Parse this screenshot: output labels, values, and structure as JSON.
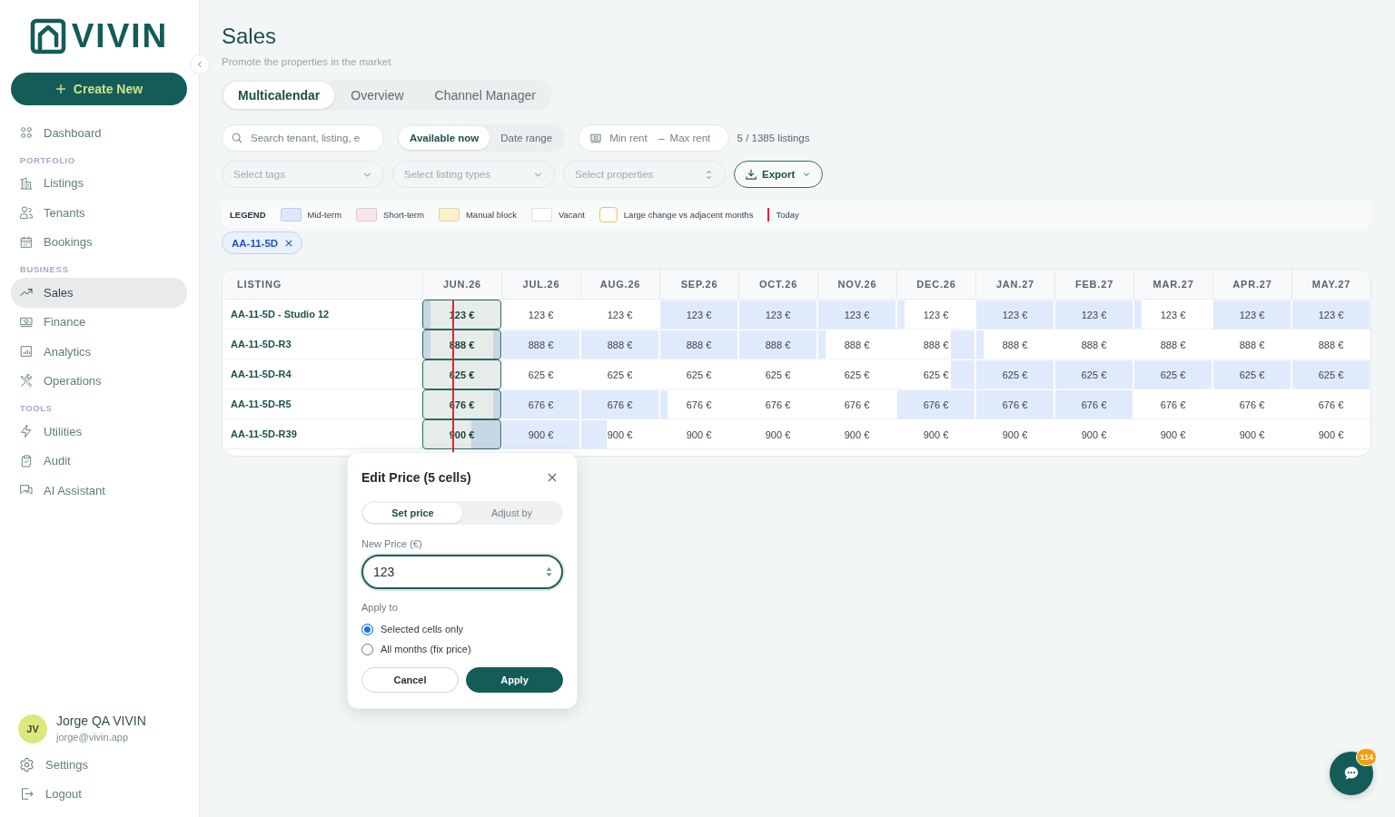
{
  "sidebar": {
    "logo_text": "VIVIN",
    "create_button": "Create New",
    "nav_groups": [
      {
        "items": [
          {
            "label": "Dashboard",
            "selected": false
          }
        ]
      },
      {
        "heading": "PORTFOLIO",
        "items": [
          {
            "label": "Listings",
            "selected": false
          },
          {
            "label": "Tenants",
            "selected": false
          },
          {
            "label": "Bookings",
            "selected": false
          }
        ]
      },
      {
        "heading": "BUSINESS",
        "items": [
          {
            "label": "Sales",
            "selected": true
          },
          {
            "label": "Finance",
            "selected": false
          },
          {
            "label": "Analytics",
            "selected": false
          },
          {
            "label": "Operations",
            "selected": false
          }
        ]
      },
      {
        "heading": "TOOLS",
        "items": [
          {
            "label": "Utilities",
            "selected": false
          },
          {
            "label": "Audit",
            "selected": false
          },
          {
            "label": "AI Assistant",
            "selected": false
          }
        ]
      }
    ],
    "user": {
      "initials": "JV",
      "name": "Jorge QA VIVIN",
      "email": "jorge@vivin.app"
    },
    "account_links": [
      {
        "label": "Settings"
      },
      {
        "label": "Logout"
      }
    ]
  },
  "header": {
    "title": "Sales",
    "subtitle": "Promote the properties in the market"
  },
  "tabs": [
    {
      "label": "Multicalendar",
      "selected": true
    },
    {
      "label": "Overview",
      "selected": false
    },
    {
      "label": "Channel Manager",
      "selected": false
    }
  ],
  "filters": {
    "search": {
      "placeholder": "Search tenant, listing, e"
    },
    "availability": [
      {
        "label": "Available now",
        "selected": true
      },
      {
        "label": "Date range",
        "selected": false
      }
    ],
    "rent": {
      "min": {
        "placeholder": "Min rent"
      },
      "separator": "–",
      "max": {
        "placeholder": "Max rent"
      }
    },
    "result_count": "5 / 1385 listings",
    "selects": [
      {
        "kind": "dropdown",
        "placeholder": "Select tags"
      },
      {
        "kind": "dropdown",
        "placeholder": "Select listing types"
      },
      {
        "kind": "sort",
        "placeholder": "Select properties"
      }
    ],
    "export_button": "Export"
  },
  "legend": {
    "title": "LEGEND",
    "items": [
      {
        "kind": "fill",
        "label": "Mid-term",
        "color": "#dce8fb"
      },
      {
        "kind": "fill",
        "label": "Short-term",
        "color": "#fce4ee"
      },
      {
        "kind": "fill",
        "label": "Manual block",
        "color": "#fdf0c6"
      },
      {
        "kind": "fill",
        "label": "Vacant",
        "color": "#ffffff"
      },
      {
        "kind": "outline",
        "label": "Large change vs adjacent months",
        "color": "#f5c23c"
      },
      {
        "kind": "line",
        "label": "Today",
        "color": "#e0262f"
      }
    ]
  },
  "active_filters": [
    {
      "label": "AA-11-5D"
    }
  ],
  "table": {
    "listing_header": "LISTING",
    "columns": [
      {
        "label": "JUN.26",
        "today": true
      },
      {
        "label": "JUL.26",
        "today": false
      },
      {
        "label": "AUG.26",
        "today": false
      },
      {
        "label": "SEP.26",
        "today": false
      },
      {
        "label": "OCT.26",
        "today": false
      },
      {
        "label": "NOV.26",
        "today": false
      },
      {
        "label": "DEC.26",
        "today": false
      },
      {
        "label": "JAN.27",
        "today": false
      },
      {
        "label": "FEB.27",
        "today": false
      },
      {
        "label": "MAR.27",
        "today": false
      },
      {
        "label": "APR.27",
        "today": false
      },
      {
        "label": "MAY.27",
        "today": false
      }
    ],
    "rows": [
      {
        "listing": "AA-11-5D - Studio 12",
        "cells": [
          {
            "price": "123 €",
            "selected": true,
            "kind": "end"
          },
          {
            "price": "123 €",
            "selected": false,
            "kind": "none"
          },
          {
            "price": "123 €",
            "selected": false,
            "kind": "none"
          },
          {
            "price": "123 €",
            "selected": false,
            "kind": "full"
          },
          {
            "price": "123 €",
            "selected": false,
            "kind": "full"
          },
          {
            "price": "123 €",
            "selected": false,
            "kind": "full"
          },
          {
            "price": "123 €",
            "selected": false,
            "kind": "end"
          },
          {
            "price": "123 €",
            "selected": false,
            "kind": "full"
          },
          {
            "price": "123 €",
            "selected": false,
            "kind": "full"
          },
          {
            "price": "123 €",
            "selected": false,
            "kind": "end"
          },
          {
            "price": "123 €",
            "selected": false,
            "kind": "full"
          },
          {
            "price": "123 €",
            "selected": false,
            "kind": "full"
          }
        ]
      },
      {
        "listing": "AA-11-5D-R3",
        "cells": [
          {
            "price": "888 €",
            "selected": true,
            "kind": "end-start"
          },
          {
            "price": "888 €",
            "selected": false,
            "kind": "full"
          },
          {
            "price": "888 €",
            "selected": false,
            "kind": "full"
          },
          {
            "price": "888 €",
            "selected": false,
            "kind": "full"
          },
          {
            "price": "888 €",
            "selected": false,
            "kind": "full"
          },
          {
            "price": "888 €",
            "selected": false,
            "kind": "end"
          },
          {
            "price": "888 €",
            "selected": false,
            "kind": "start"
          },
          {
            "price": "888 €",
            "selected": false,
            "kind": "end"
          },
          {
            "price": "888 €",
            "selected": false,
            "kind": "none"
          },
          {
            "price": "888 €",
            "selected": false,
            "kind": "none"
          },
          {
            "price": "888 €",
            "selected": false,
            "kind": "none"
          },
          {
            "price": "888 €",
            "selected": false,
            "kind": "none"
          }
        ]
      },
      {
        "listing": "AA-11-5D-R4",
        "cells": [
          {
            "price": "625 €",
            "selected": true,
            "kind": "none"
          },
          {
            "price": "625 €",
            "selected": false,
            "kind": "none"
          },
          {
            "price": "625 €",
            "selected": false,
            "kind": "none"
          },
          {
            "price": "625 €",
            "selected": false,
            "kind": "none"
          },
          {
            "price": "625 €",
            "selected": false,
            "kind": "none"
          },
          {
            "price": "625 €",
            "selected": false,
            "kind": "none"
          },
          {
            "price": "625 €",
            "selected": false,
            "kind": "start"
          },
          {
            "price": "625 €",
            "selected": false,
            "kind": "full"
          },
          {
            "price": "625 €",
            "selected": false,
            "kind": "full"
          },
          {
            "price": "625 €",
            "selected": false,
            "kind": "full"
          },
          {
            "price": "625 €",
            "selected": false,
            "kind": "full"
          },
          {
            "price": "625 €",
            "selected": false,
            "kind": "full"
          }
        ]
      },
      {
        "listing": "AA-11-5D-R5",
        "cells": [
          {
            "price": "676 €",
            "selected": true,
            "kind": "start-short"
          },
          {
            "price": "676 €",
            "selected": false,
            "kind": "full"
          },
          {
            "price": "676 €",
            "selected": false,
            "kind": "full"
          },
          {
            "price": "676 €",
            "selected": false,
            "kind": "end"
          },
          {
            "price": "676 €",
            "selected": false,
            "kind": "none"
          },
          {
            "price": "676 €",
            "selected": false,
            "kind": "none"
          },
          {
            "price": "676 €",
            "selected": false,
            "kind": "full"
          },
          {
            "price": "676 €",
            "selected": false,
            "kind": "full"
          },
          {
            "price": "676 €",
            "selected": false,
            "kind": "full"
          },
          {
            "price": "676 €",
            "selected": false,
            "kind": "none"
          },
          {
            "price": "676 €",
            "selected": false,
            "kind": "none"
          },
          {
            "price": "676 €",
            "selected": false,
            "kind": "none"
          }
        ]
      },
      {
        "listing": "AA-11-5D-R39",
        "cells": [
          {
            "price": "900 €",
            "selected": true,
            "kind": "start-long"
          },
          {
            "price": "900 €",
            "selected": false,
            "kind": "full"
          },
          {
            "price": "900 €",
            "selected": false,
            "kind": "end-long"
          },
          {
            "price": "900 €",
            "selected": false,
            "kind": "none"
          },
          {
            "price": "900 €",
            "selected": false,
            "kind": "none"
          },
          {
            "price": "900 €",
            "selected": false,
            "kind": "none"
          },
          {
            "price": "900 €",
            "selected": false,
            "kind": "none"
          },
          {
            "price": "900 €",
            "selected": false,
            "kind": "none"
          },
          {
            "price": "900 €",
            "selected": false,
            "kind": "none"
          },
          {
            "price": "900 €",
            "selected": false,
            "kind": "none"
          },
          {
            "price": "900 €",
            "selected": false,
            "kind": "none"
          },
          {
            "price": "900 €",
            "selected": false,
            "kind": "none"
          }
        ]
      }
    ]
  },
  "edit_price": {
    "title": "Edit Price (5 cells)",
    "modes": [
      {
        "label": "Set price",
        "selected": true
      },
      {
        "label": "Adjust by",
        "selected": false
      }
    ],
    "field": {
      "label": "New Price (€)",
      "value": "123"
    },
    "apply_to": {
      "label": "Apply to",
      "options": [
        {
          "label": "Selected cells only",
          "selected": true
        },
        {
          "label": "All months (fix price)",
          "selected": false
        }
      ]
    },
    "buttons": [
      {
        "kind": "secondary",
        "label": "Cancel"
      },
      {
        "kind": "primary",
        "label": "Apply"
      }
    ]
  },
  "chat": {
    "badge": "114"
  }
}
